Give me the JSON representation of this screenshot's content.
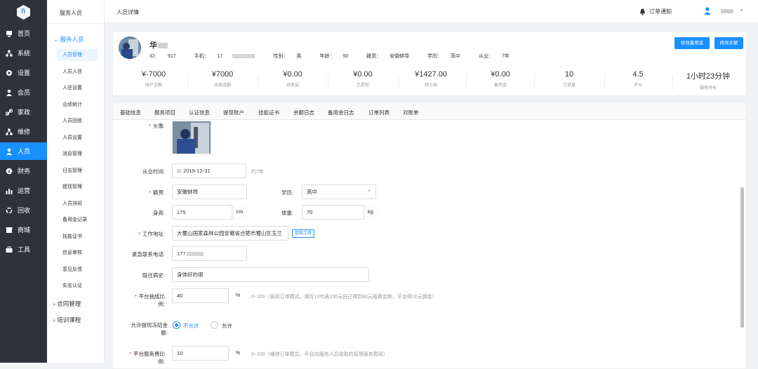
{
  "rail": {
    "items": [
      {
        "label": "首页",
        "icon": "monitor-icon"
      },
      {
        "label": "系统",
        "icon": "org-icon"
      },
      {
        "label": "设置",
        "icon": "gear-icon"
      },
      {
        "label": "会员",
        "icon": "user-icon"
      },
      {
        "label": "家政",
        "icon": "link-icon"
      },
      {
        "label": "维修",
        "icon": "org-icon"
      },
      {
        "label": "人员",
        "icon": "user-icon"
      },
      {
        "label": "财务",
        "icon": "money-icon"
      },
      {
        "label": "运营",
        "icon": "chart-icon"
      },
      {
        "label": "回收",
        "icon": "recycle-icon"
      },
      {
        "label": "商城",
        "icon": "shop-icon"
      },
      {
        "label": "工具",
        "icon": "toolbox-icon"
      }
    ]
  },
  "submenu": {
    "title": "服务人员",
    "group_open": "服务人员",
    "items": [
      "人员管理",
      "人员入驻",
      "入驻设置",
      "业绩统计",
      "人员回收",
      "人员设置",
      "消息管理",
      "日志管理",
      "提现管理",
      "人员排班",
      "备用金记录",
      "技能证书",
      "信息审核",
      "意见反馈",
      "实名认证"
    ],
    "group_contract": "合同管理",
    "group_training": "培训课程"
  },
  "topbar": {
    "title": "人员详情",
    "notify": "订单通知"
  },
  "profile": {
    "name": "华",
    "id_label": "ID：",
    "id_value": "517",
    "phone_label": "手机：",
    "phone_value": "17",
    "gender_label": "性别：",
    "gender_value": "男",
    "age_label": "年龄：",
    "age_value": "50",
    "origin_label": "籍贯：",
    "origin_value": "安徽蚌埠",
    "edu_label": "学历：",
    "edu_value": "高中",
    "exp_label": "从业：",
    "exp_value": "7年",
    "btn_reserve": "修改备用金",
    "btn_balance": "修改余额",
    "stats": [
      {
        "value": "¥-7000",
        "label": "账户余额"
      },
      {
        "value": "¥7000",
        "label": "冻结金额"
      },
      {
        "value": "¥0.00",
        "label": "总收益"
      },
      {
        "value": "¥0.00",
        "label": "已提现"
      },
      {
        "value": "¥1427.00",
        "label": "待入账"
      },
      {
        "value": "¥0.00",
        "label": "备用金"
      },
      {
        "value": "10",
        "label": "订单量"
      },
      {
        "value": "4.5",
        "label": "评分"
      },
      {
        "value": "1小时23分钟",
        "label": "服务时长"
      }
    ]
  },
  "tabs": [
    "基础信息",
    "服务项目",
    "认证信息",
    "提现账户",
    "技能证书",
    "余额日志",
    "备用金日志",
    "订单列表",
    "对账单"
  ],
  "form": {
    "avatar_label": "头像:",
    "since_label": "从业时间:",
    "since_value": "2019-12-31",
    "since_hint": "约7年",
    "origin_label": "籍贯:",
    "origin_value": "安徽蚌埠",
    "edu_label": "学历:",
    "edu_value": "高中",
    "height_label": "身高:",
    "height_value": "175",
    "height_unit": "cm",
    "weight_label": "体重:",
    "weight_value": "70",
    "weight_unit": "kg",
    "address_label": "工作地址:",
    "address_value": "大蜀山国家森林公园安徽省合肥市蜀山区玉兰",
    "address_btn": "拾取工具",
    "emergency_label": "紧急联系电话:",
    "emergency_value": "177",
    "history_label": "既往病史:",
    "history_value": "身体好的很",
    "commission_label_1": "平台抽成比",
    "commission_label_2": "例:",
    "commission_value": "40",
    "commission_unit": "%",
    "commission_hint": "0~100（家政订单模式，填写10代表100元自己得到90元结算金额，平台得10元佣金）",
    "freeze_label_1": "允许提现冻结金",
    "freeze_label_2": "额:",
    "freeze_opt_no": "不允许",
    "freeze_opt_yes": "允许",
    "fee_label_1": "平台服务费比",
    "fee_label_2": "例:",
    "fee_value": "10",
    "fee_unit": "%",
    "fee_hint": "0~100（维修订单模式，平台向服务人员收取的管理服务费用）"
  }
}
